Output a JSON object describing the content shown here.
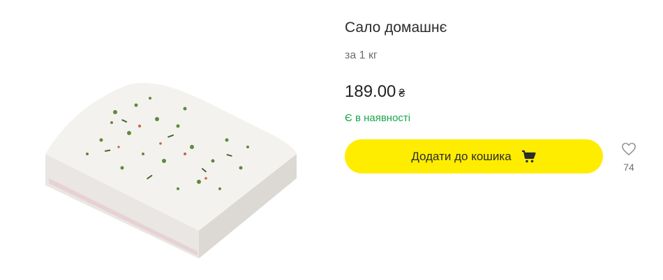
{
  "product": {
    "image_alt": "Сало домашнє",
    "title": "Сало домашнє",
    "unit": "за 1 кг",
    "price": "189.00",
    "currency": "₴",
    "availability": "Є в наявності",
    "add_to_cart_label": "Додати до кошика",
    "cart_icon": "cart-icon",
    "wishlist_icon": "heart-icon",
    "wishlist_count": "74"
  },
  "colors": {
    "button_bg": "#ffed00",
    "stock_green": "#17a64a"
  }
}
